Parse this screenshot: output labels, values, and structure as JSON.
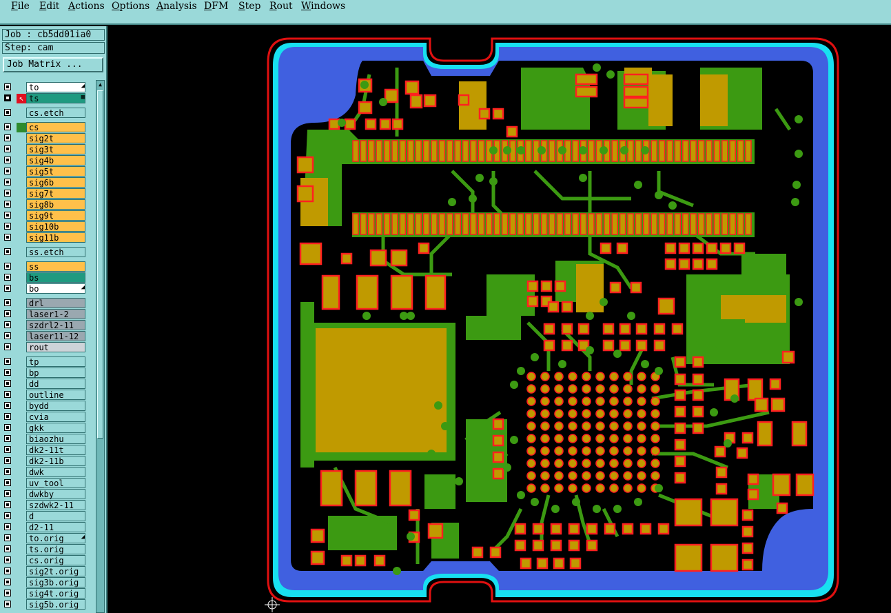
{
  "menu": [
    "File",
    "Edit",
    "Actions",
    "Options",
    "Analysis",
    "DFM",
    "Step",
    "Rout",
    "Windows"
  ],
  "job": {
    "label": "Job : cb5dd01ia0",
    "step": "Step: cam",
    "matrix_button": "Job Matrix ..."
  },
  "layers": [
    {
      "name": "to",
      "color": "white",
      "flag": "◢"
    },
    {
      "name": "ts",
      "color": "teal",
      "flag": "▦",
      "checked": true,
      "marker": "red"
    },
    {
      "name": "cs.etch",
      "color": "cyan",
      "gap": true
    },
    {
      "name": "cs",
      "color": "orange",
      "marker": "green",
      "gap": true
    },
    {
      "name": "sig2t",
      "color": "orange"
    },
    {
      "name": "sig3t",
      "color": "orange"
    },
    {
      "name": "sig4b",
      "color": "orange"
    },
    {
      "name": "sig5t",
      "color": "orange"
    },
    {
      "name": "sig6b",
      "color": "orange"
    },
    {
      "name": "sig7t",
      "color": "orange"
    },
    {
      "name": "sig8b",
      "color": "orange"
    },
    {
      "name": "sig9t",
      "color": "orange"
    },
    {
      "name": "sig10b",
      "color": "orange"
    },
    {
      "name": "sig11b",
      "color": "orange"
    },
    {
      "name": "ss.etch",
      "color": "cyan",
      "gap": true
    },
    {
      "name": "ss",
      "color": "orange",
      "gap": true
    },
    {
      "name": "bs",
      "color": "teal"
    },
    {
      "name": "bo",
      "color": "white",
      "flag": "◢"
    },
    {
      "name": "drl",
      "color": "gray",
      "gap": true
    },
    {
      "name": "laser1-2",
      "color": "gray"
    },
    {
      "name": "szdrl2-11",
      "color": "gray"
    },
    {
      "name": "laser11-12",
      "color": "gray"
    },
    {
      "name": "rout",
      "color": "ltgray"
    },
    {
      "name": "tp",
      "color": "cyan",
      "gap": true
    },
    {
      "name": "bp",
      "color": "cyan"
    },
    {
      "name": "dd",
      "color": "cyan"
    },
    {
      "name": "outline",
      "color": "cyan"
    },
    {
      "name": "bydd",
      "color": "cyan"
    },
    {
      "name": "cvia",
      "color": "cyan"
    },
    {
      "name": "gkk",
      "color": "cyan"
    },
    {
      "name": "biaozhu",
      "color": "cyan"
    },
    {
      "name": "dk2-11t",
      "color": "cyan"
    },
    {
      "name": "dk2-11b",
      "color": "cyan"
    },
    {
      "name": "dwk",
      "color": "cyan"
    },
    {
      "name": "uv_tool",
      "color": "cyan"
    },
    {
      "name": "dwkby",
      "color": "cyan"
    },
    {
      "name": "szdwk2-11",
      "color": "cyan"
    },
    {
      "name": "d",
      "color": "cyan"
    },
    {
      "name": "d2-11",
      "color": "cyan"
    },
    {
      "name": "to.orig",
      "color": "cyan",
      "flag": "◢"
    },
    {
      "name": "ts.orig",
      "color": "cyan"
    },
    {
      "name": "cs.orig",
      "color": "cyan"
    },
    {
      "name": "sig2t.orig",
      "color": "cyan"
    },
    {
      "name": "sig3b.orig",
      "color": "cyan"
    },
    {
      "name": "sig4t.orig",
      "color": "cyan"
    },
    {
      "name": "sig5b.orig",
      "color": "cyan"
    }
  ],
  "colors": {
    "panel": "#9ad9d9",
    "outline_red": "#e01010",
    "outline_cyan": "#18e0f0",
    "mask_blue": "#4060e0",
    "copper_green": "#3c9a12",
    "pad_gold": "#c09a00",
    "pad_outline": "#ff2020",
    "background": "#000000"
  },
  "icons": {
    "crosshair": "crosshair-icon",
    "scroll_up": "scroll-up-arrow-icon"
  }
}
